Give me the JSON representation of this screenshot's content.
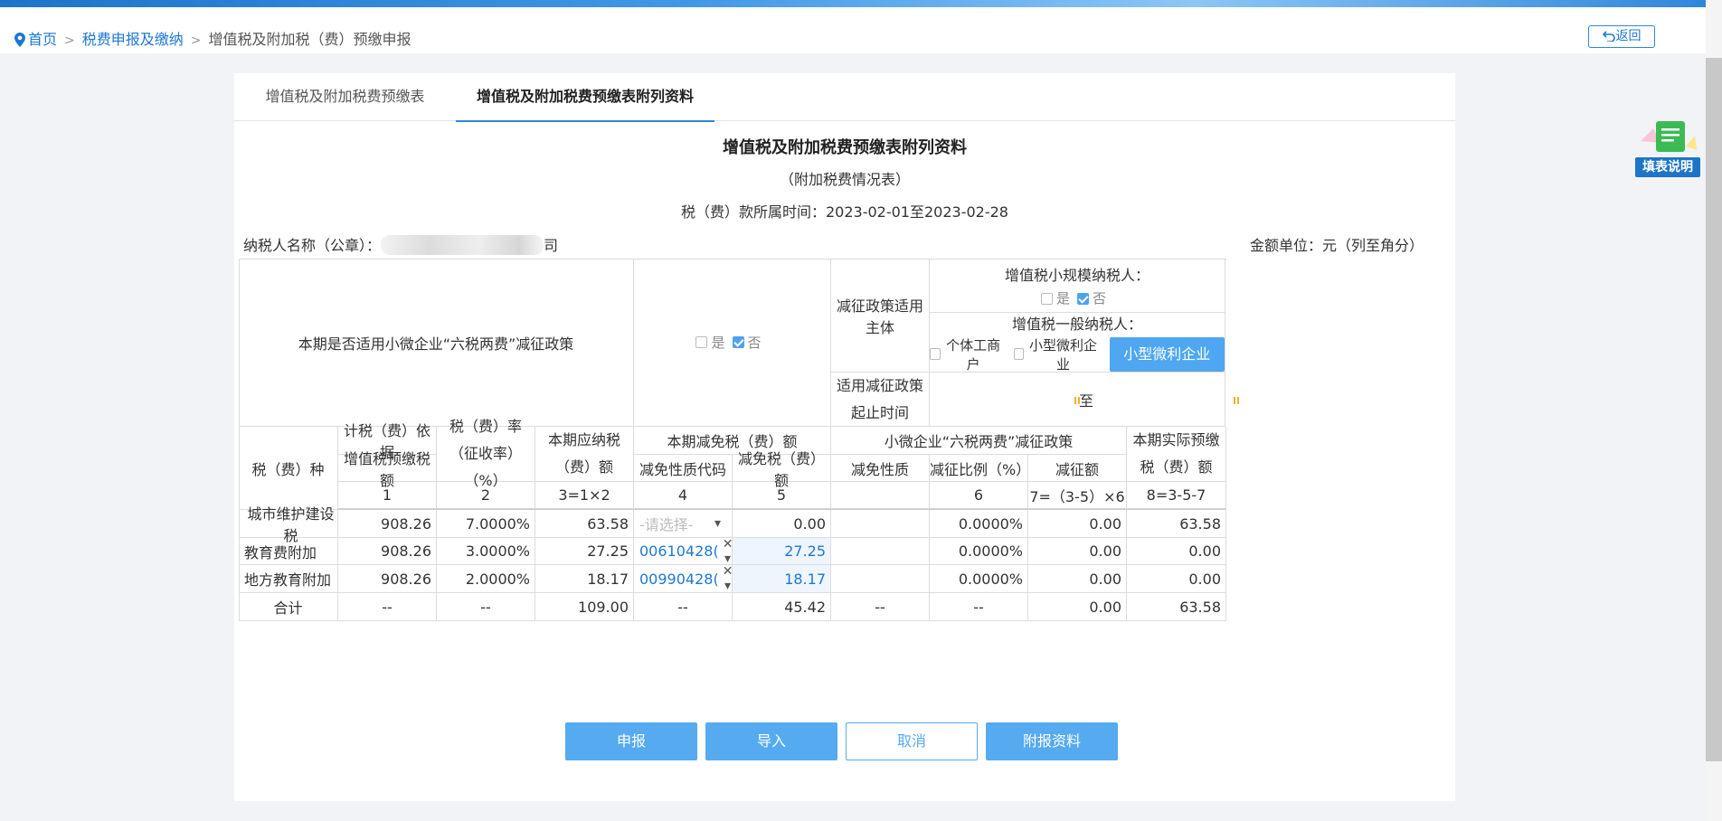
{
  "breadcrumb": {
    "home": "首页",
    "level2": "税费申报及缴纳",
    "current": "增值税及附加税（费）预缴申报",
    "sep": ">"
  },
  "back_label": "返回",
  "help_label": "填表说明",
  "tabs": [
    "增值税及附加税费预缴表",
    "增值税及附加税费预缴表附列资料"
  ],
  "form": {
    "title": "增值税及附加税费预缴表附列资料",
    "subtitle": "（附加税费情况表）",
    "period": "税（费）款所属时间：2023-02-01至2023-02-28",
    "payer_label": "纳税人名称（公章）：",
    "payer_tail": "司",
    "unit": "金额单位：元（列至角分）"
  },
  "policy": {
    "question": "本期是否适用小微企业“六税两费”减征政策",
    "yes": "是",
    "no": "否",
    "subject_label": "减征政策适用主体",
    "small_scale_label": "增值税小规模纳税人：",
    "general_label": "增值税一般纳税人：",
    "individual": "个体工商户",
    "small_micro": "小型微利企业",
    "standard_btn": "小型微利企业标准",
    "period_label": "适用减征政策起止时间",
    "to": "至"
  },
  "headers": {
    "tax_type": "税（费）种",
    "basis": "计税（费）依据",
    "basis_sub": "增值税预缴税额",
    "rate": "税（费）率（征收率）（%）",
    "payable": "本期应纳税（费）额",
    "reduction": "本期减免税（费）额",
    "reduction_code": "减免性质代码",
    "reduction_amount": "减免税（费）额",
    "six_two": "小微企业“六税两费”减征政策",
    "six_nature": "减免性质",
    "six_ratio": "减征比例（%）",
    "six_amount": "减征额",
    "actual": "本期实际预缴税（费）额",
    "col_nums": [
      "1",
      "2",
      "3=1×2",
      "4",
      "5",
      "",
      "6",
      "7=（3-5）×6",
      "8=3-5-7"
    ]
  },
  "rows": [
    {
      "name": "城市维护建设税",
      "basis": "908.26",
      "rate": "7.0000%",
      "payable": "63.58",
      "code": "",
      "code_placeholder": "-请选择-",
      "amount": "0.00",
      "nature": "",
      "ratio": "0.0000%",
      "reduce": "0.00",
      "actual": "63.58"
    },
    {
      "name": "教育费附加",
      "basis": "908.26",
      "rate": "3.0000%",
      "payable": "27.25",
      "code": "00610428(",
      "amount": "27.25",
      "nature": "",
      "ratio": "0.0000%",
      "reduce": "0.00",
      "actual": "0.00"
    },
    {
      "name": "地方教育附加",
      "basis": "908.26",
      "rate": "2.0000%",
      "payable": "18.17",
      "code": "00990428(",
      "amount": "18.17",
      "nature": "",
      "ratio": "0.0000%",
      "reduce": "0.00",
      "actual": "0.00"
    }
  ],
  "total": {
    "name": "合计",
    "basis": "--",
    "rate": "--",
    "payable": "109.00",
    "code": "--",
    "amount": "45.42",
    "nature": "--",
    "ratio": "--",
    "reduce": "0.00",
    "actual": "63.58"
  },
  "buttons": {
    "submit": "申报",
    "import": "导入",
    "cancel": "取消",
    "attach": "附报资料"
  },
  "colors": {
    "accent": "#2f86da",
    "button": "#55aaf0",
    "calendar": "#f5b130"
  }
}
